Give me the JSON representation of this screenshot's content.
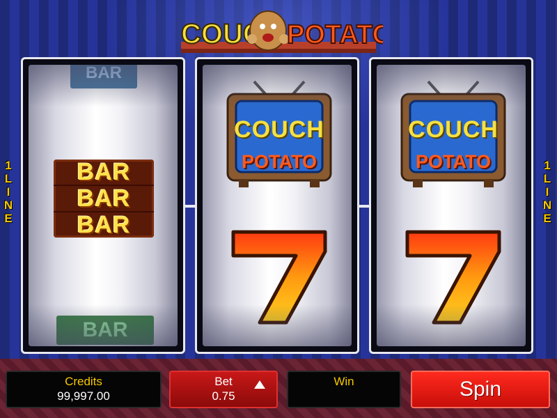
{
  "game": {
    "logo_line1": "COUCH",
    "logo_line2": "POTATO",
    "brand_colors": {
      "logo_yellow": "#f6e040",
      "logo_orange": "#ff5a1e",
      "bar_gold": "#ffe14a",
      "spin_red": "#ff2a1e"
    }
  },
  "paylines": {
    "left": [
      "1",
      "L",
      "I",
      "N",
      "E"
    ],
    "right": [
      "1",
      "L",
      "I",
      "N",
      "E"
    ]
  },
  "reels": [
    {
      "symbols": [
        {
          "name": "single-bar-blue",
          "text": "BAR"
        },
        {
          "name": "triple-bar",
          "rows": [
            "BAR",
            "BAR",
            "BAR"
          ]
        },
        {
          "name": "single-bar-green",
          "text": "BAR"
        }
      ]
    },
    {
      "symbols": [
        {
          "name": "couch-potato-tv",
          "line1": "COUCH",
          "line2": "POTATO"
        },
        {
          "name": "seven",
          "text": "7"
        }
      ]
    },
    {
      "symbols": [
        {
          "name": "couch-potato-tv",
          "line1": "COUCH",
          "line2": "POTATO"
        },
        {
          "name": "seven",
          "text": "7"
        }
      ]
    }
  ],
  "controls": {
    "credits_label": "Credits",
    "credits_value": "99,997.00",
    "bet_label": "Bet",
    "bet_value": "0.75",
    "win_label": "Win",
    "win_value": "",
    "spin_label": "Spin"
  }
}
